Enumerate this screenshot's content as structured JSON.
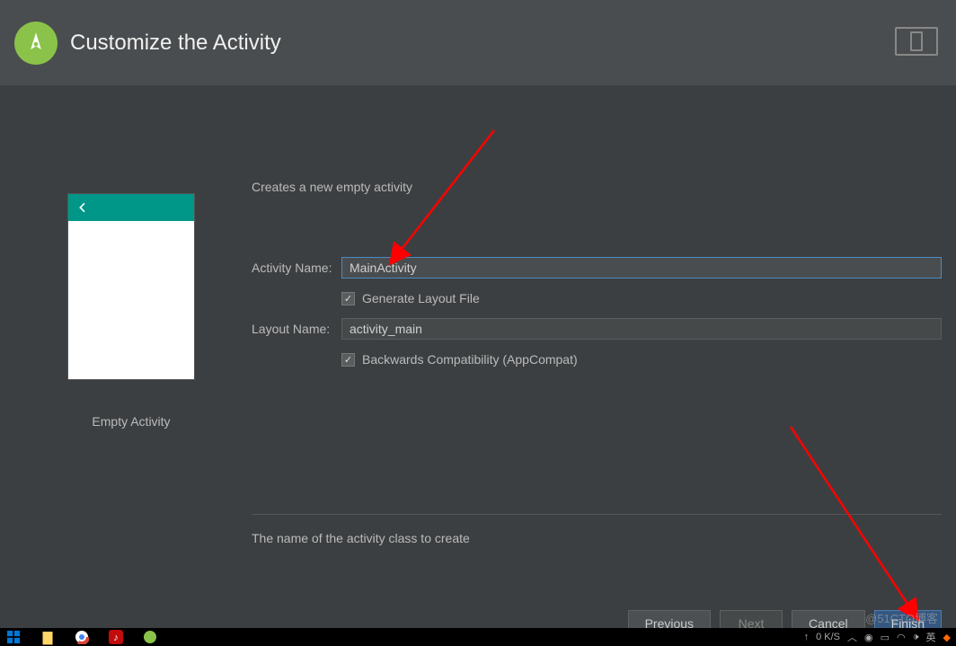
{
  "header": {
    "title": "Customize the Activity"
  },
  "subtitle": "Creates a new empty activity",
  "preview": {
    "caption": "Empty Activity"
  },
  "form": {
    "activity_name_label": "Activity Name:",
    "activity_name_value": "MainActivity",
    "generate_layout_label": "Generate Layout File",
    "generate_layout_checked": true,
    "layout_name_label": "Layout Name:",
    "layout_name_value": "activity_main",
    "backwards_compat_label": "Backwards Compatibility (AppCompat)",
    "backwards_compat_checked": true
  },
  "helper_text": "The name of the activity class to create",
  "buttons": {
    "previous": "Previous",
    "next": "Next",
    "cancel": "Cancel",
    "finish": "Finish"
  },
  "taskbar": {
    "speed": "0 K/S",
    "lang": "英"
  },
  "watermark": "@51CTO博客"
}
